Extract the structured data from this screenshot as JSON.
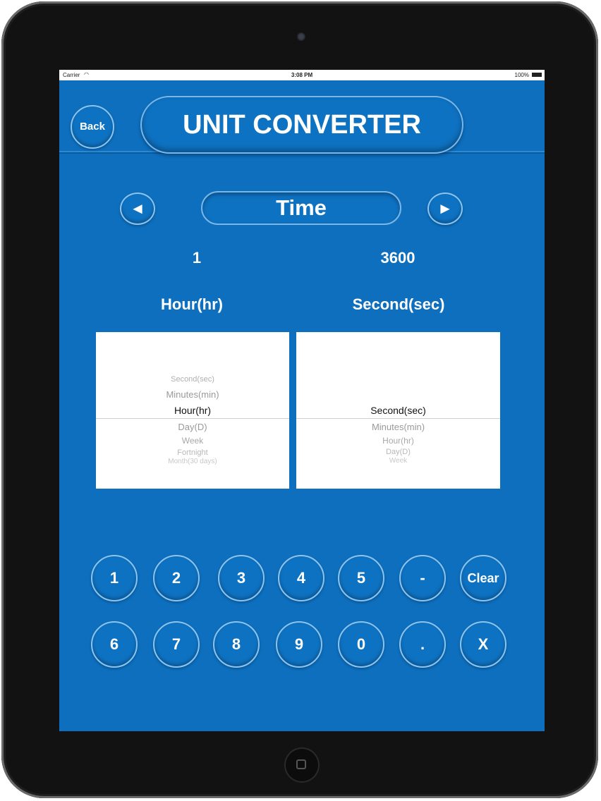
{
  "status_bar": {
    "carrier": "Carrier",
    "time": "3:08 PM",
    "battery": "100%"
  },
  "header": {
    "back_label": "Back",
    "title": "UNIT CONVERTER"
  },
  "category": {
    "prev_label": "◄",
    "name": "Time",
    "next_label": "►"
  },
  "conversion": {
    "from_value": "1",
    "to_value": "3600",
    "from_unit": "Hour(hr)",
    "to_unit": "Second(sec)"
  },
  "picker_left": {
    "items": [
      "Second(sec)",
      "Minutes(min)",
      "Hour(hr)",
      "Day(D)",
      "Week",
      "Fortnight",
      "Month(30 days)"
    ],
    "selected": "Hour(hr)"
  },
  "picker_right": {
    "items": [
      "Second(sec)",
      "Minutes(min)",
      "Hour(hr)",
      "Day(D)",
      "Week"
    ],
    "selected": "Second(sec)"
  },
  "keypad": {
    "row1": [
      "1",
      "2",
      "3",
      "4",
      "5",
      "-",
      "Clear"
    ],
    "row2": [
      "6",
      "7",
      "8",
      "9",
      "0",
      ".",
      "X"
    ]
  },
  "colors": {
    "background": "#0d6fbd",
    "button_border": "#8cc4ee"
  }
}
